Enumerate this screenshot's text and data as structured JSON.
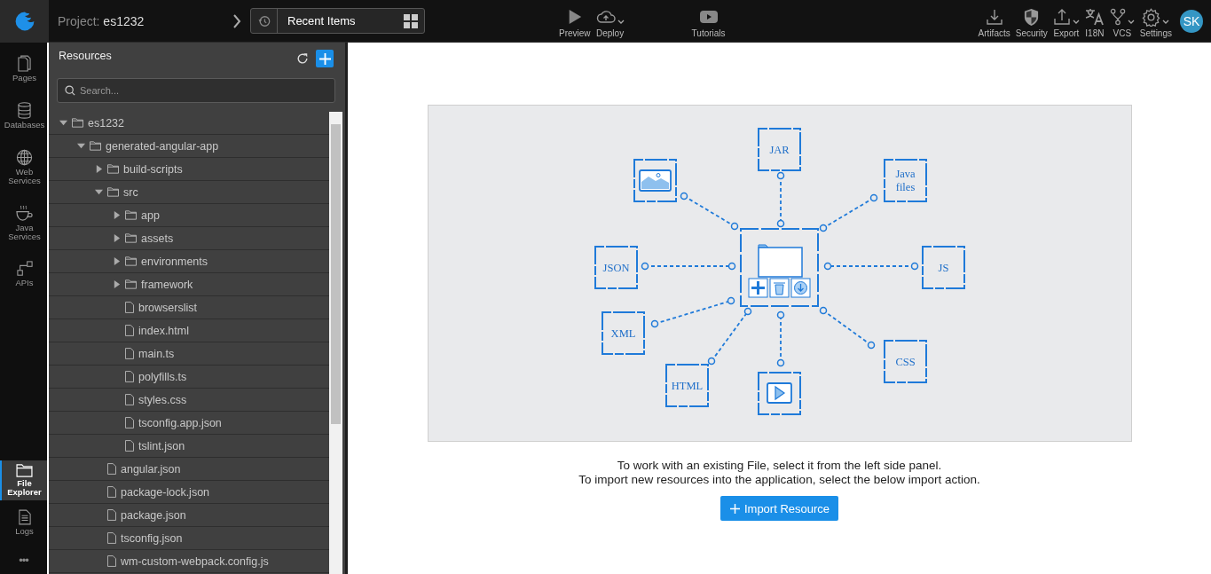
{
  "header": {
    "project_label": "Project:",
    "project_name": "es1232",
    "recent": {
      "label": "Recent Items"
    },
    "left_tools": [
      {
        "label": "Preview",
        "dropdown": false
      },
      {
        "label": "Deploy",
        "dropdown": true
      },
      {
        "label": "Tutorials",
        "dropdown": false
      }
    ],
    "right_tools": [
      {
        "label": "Artifacts",
        "dropdown": false
      },
      {
        "label": "Security",
        "dropdown": false
      },
      {
        "label": "Export",
        "dropdown": true
      },
      {
        "label": "I18N",
        "dropdown": false
      },
      {
        "label": "VCS",
        "dropdown": true
      },
      {
        "label": "Settings",
        "dropdown": true
      }
    ],
    "avatar": "SK"
  },
  "rail": {
    "top_items": [
      {
        "label": "Pages",
        "selected": false
      },
      {
        "label": "Databases",
        "selected": false
      },
      {
        "label": "Web Services",
        "selected": false
      },
      {
        "label": "Java Services",
        "selected": false
      },
      {
        "label": "APIs",
        "selected": false
      }
    ],
    "bottom_items": [
      {
        "label": "File Explorer",
        "selected": true
      },
      {
        "label": "Logs",
        "selected": false
      }
    ],
    "more": "•••"
  },
  "panel": {
    "title": "Resources",
    "search": {
      "placeholder": "Search..."
    },
    "tree": [
      {
        "label": "es1232",
        "kind": "folder",
        "expanded": true,
        "children": [
          {
            "label": "generated-angular-app",
            "kind": "folder",
            "expanded": true,
            "children": [
              {
                "label": "build-scripts",
                "kind": "folder",
                "expanded": false
              },
              {
                "label": "src",
                "kind": "folder",
                "expanded": true,
                "children": [
                  {
                    "label": "app",
                    "kind": "folder",
                    "expanded": false
                  },
                  {
                    "label": "assets",
                    "kind": "folder",
                    "expanded": false
                  },
                  {
                    "label": "environments",
                    "kind": "folder",
                    "expanded": false
                  },
                  {
                    "label": "framework",
                    "kind": "folder",
                    "expanded": false
                  },
                  {
                    "label": "browserslist",
                    "kind": "file"
                  },
                  {
                    "label": "index.html",
                    "kind": "file"
                  },
                  {
                    "label": "main.ts",
                    "kind": "file"
                  },
                  {
                    "label": "polyfills.ts",
                    "kind": "file"
                  },
                  {
                    "label": "styles.css",
                    "kind": "file"
                  },
                  {
                    "label": "tsconfig.app.json",
                    "kind": "file"
                  },
                  {
                    "label": "tslint.json",
                    "kind": "file"
                  }
                ]
              },
              {
                "label": "angular.json",
                "kind": "file"
              },
              {
                "label": "package-lock.json",
                "kind": "file"
              },
              {
                "label": "package.json",
                "kind": "file"
              },
              {
                "label": "tsconfig.json",
                "kind": "file"
              },
              {
                "label": "wm-custom-webpack.config.js",
                "kind": "file"
              }
            ]
          }
        ]
      }
    ]
  },
  "main": {
    "illustration": {
      "nodes": [
        {
          "kind": "image"
        },
        {
          "kind": "text",
          "label": "JAR"
        },
        {
          "kind": "text",
          "label": "Java files"
        },
        {
          "kind": "text",
          "label": "JSON"
        },
        {
          "kind": "text",
          "label": "JS"
        },
        {
          "kind": "text",
          "label": "XML"
        },
        {
          "kind": "text",
          "label": "HTML"
        },
        {
          "kind": "video"
        },
        {
          "kind": "text",
          "label": "CSS"
        }
      ]
    },
    "message_lines": [
      "To work with an existing File, select it from the left side panel.",
      "To import new resources into the application, select the below import action."
    ],
    "import_button": "Import Resource"
  }
}
